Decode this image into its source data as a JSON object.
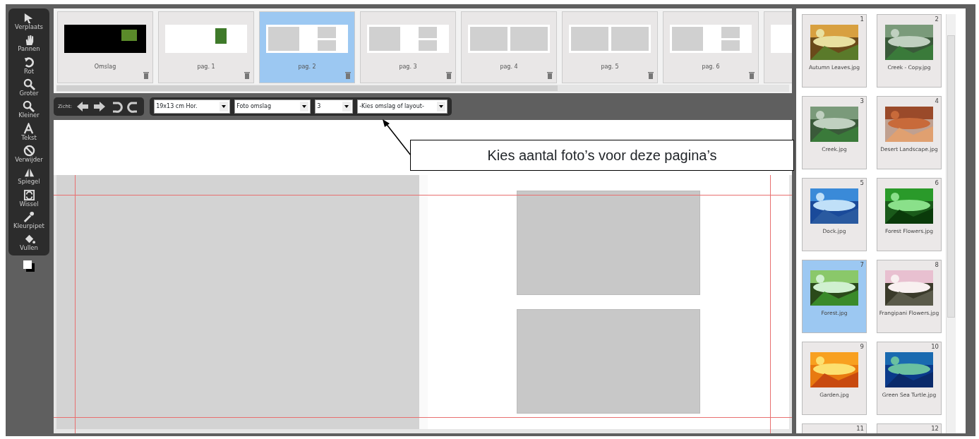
{
  "tools": [
    {
      "kind": "pointer",
      "label": "Verplaats"
    },
    {
      "kind": "hand",
      "label": "Pannen"
    },
    {
      "kind": "rotate",
      "label": "Rot"
    },
    {
      "kind": "zoom",
      "label": "Groter"
    },
    {
      "kind": "zoom",
      "label": "Kleiner"
    },
    {
      "kind": "text",
      "label": "Tekst"
    },
    {
      "kind": "forbid",
      "label": "Verwijder"
    },
    {
      "kind": "mirror",
      "label": "Spiegel"
    },
    {
      "kind": "swap",
      "label": "Wissel"
    },
    {
      "kind": "pipette",
      "label": "Kleurpipet"
    },
    {
      "kind": "fill",
      "label": "Vullen"
    }
  ],
  "pages": [
    {
      "kind": "cover",
      "label": "Omslag",
      "selected": false
    },
    {
      "kind": "single",
      "label": "pag. 1",
      "selected": false
    },
    {
      "kind": "full-two",
      "label": "pag. 2",
      "selected": true
    },
    {
      "kind": "full-two",
      "label": "pag. 3",
      "selected": false
    },
    {
      "kind": "two",
      "label": "pag. 4",
      "selected": false
    },
    {
      "kind": "two",
      "label": "pag. 5",
      "selected": false
    },
    {
      "kind": "full-two",
      "label": "pag. 6",
      "selected": false
    },
    {
      "kind": "blank",
      "selected": false
    }
  ],
  "view_toolbar": {
    "label": "Zicht:",
    "selects": [
      {
        "value": "19x13 cm Hor."
      },
      {
        "value": "Foto omslag"
      },
      {
        "value": "3"
      },
      {
        "value": "-Kies omslag of layout-"
      }
    ]
  },
  "callout": {
    "text": "Kies aantal foto’s voor deze pagina’s"
  },
  "photos": [
    {
      "number": "1",
      "name": "Autumn Leaves.jpg",
      "selected": false
    },
    {
      "number": "2",
      "name": "Creek - Copy.jpg",
      "selected": false
    },
    {
      "number": "3",
      "name": "Creek.jpg",
      "selected": false
    },
    {
      "number": "4",
      "name": "Desert Landscape.jpg",
      "selected": false
    },
    {
      "number": "5",
      "name": "Dock.jpg",
      "selected": false
    },
    {
      "number": "6",
      "name": "Forest Flowers.jpg",
      "selected": false
    },
    {
      "number": "7",
      "name": "Forest.jpg",
      "selected": true
    },
    {
      "number": "8",
      "name": "Frangipani Flowers.jpg",
      "selected": false
    },
    {
      "number": "9",
      "name": "Garden.jpg",
      "selected": false
    },
    {
      "number": "10",
      "name": "Green Sea Turtle.jpg",
      "selected": false
    },
    {
      "number": "11",
      "selected": false
    },
    {
      "number": "12",
      "selected": false
    }
  ]
}
